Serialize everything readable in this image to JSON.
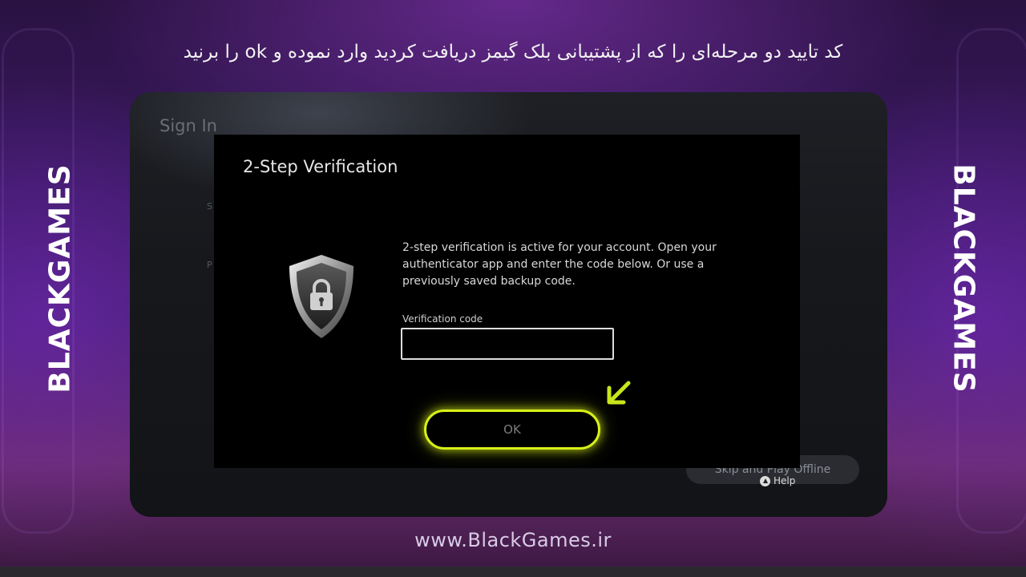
{
  "caption": "کد تایید دو مرحله‌ای را که از پشتیبانی بلک گیمز دریافت کردید وارد نموده و ok را برنید",
  "brand": {
    "left": "BLACKGAMES",
    "right": "BLACKGAMES"
  },
  "background_screen": {
    "title": "Sign In",
    "label_s": "S",
    "label_p": "P",
    "skip_label": "Skip and Play Offline",
    "help_label": "Help"
  },
  "dialog": {
    "title": "2-Step Verification",
    "body": "2-step verification is active for your account. Open your authenticator app and enter the code below. Or use a previously saved backup code.",
    "field_label": "Verification code",
    "field_value": "",
    "ok_label": "OK"
  },
  "footer": {
    "url": "www.BlackGames.ir"
  },
  "colors": {
    "accent": "#d7f018",
    "background_purple": "#3b1a63",
    "dialog_bg": "#000000"
  },
  "icons": {
    "shield": "shield-lock-icon",
    "arrow": "arrow-down-left-icon",
    "help": "triangle-button-icon"
  }
}
